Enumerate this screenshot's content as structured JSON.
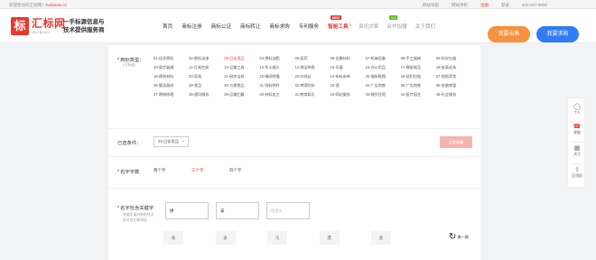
{
  "topbar": {
    "welcome": "欢迎您访问汇标网！",
    "site": "huibiaow.cn",
    "links": {
      "nav": "网站导航",
      "mobile": "网站手机",
      "register": "注册",
      "login": "登录",
      "phone": "400-027-9090"
    }
  },
  "header": {
    "logo_mark": "标",
    "logo_name": "汇标网",
    "logo_sub": "HUIBIAO",
    "slogan_line1": "一手标源信息与",
    "slogan_line2": "技术提供服务商",
    "nav": [
      {
        "label": "首页"
      },
      {
        "label": "商标注册"
      },
      {
        "label": "商标公证"
      },
      {
        "label": "商标转让"
      },
      {
        "label": "商标求购"
      },
      {
        "label": "专利服务"
      },
      {
        "label": "智能工具",
        "badge": "NEW",
        "active": true
      }
    ],
    "nav_secondary": [
      {
        "label": "资讯文章"
      },
      {
        "label": "合作加盟",
        "badge": "hot"
      },
      {
        "label": "关于我们"
      }
    ],
    "sell_button": "我要出售",
    "buy_button": "我要求购"
  },
  "form": {
    "category_label": "商标类型：",
    "category_note": "(可多选)",
    "categories": [
      "01-化学原料",
      "02-颜料油漆",
      "03-日化用品",
      "04-燃料油脂",
      "05-医药",
      "06-金属材料",
      "07-机械设备",
      "08-手工器械",
      "09-科学仪器",
      "10-医疗器械",
      "11-灯具空调",
      "12-运输工具",
      "13-军火烟火",
      "14-珠宝钟表",
      "15-乐器",
      "16-办公用品",
      "17-橡胶制品",
      "18-皮革皮具",
      "19-建筑材料",
      "20-家具",
      "21-厨房洁具",
      "22-绳网袋篷",
      "23-纱线丝",
      "24-布料床单",
      "25-服装鞋帽",
      "26-纽扣拉链",
      "27-地毯席垫",
      "28-健身器材",
      "29-食品",
      "30-方便食品",
      "31-饲料种籽",
      "32-啤酒饮料",
      "33-酒",
      "34-广告销售",
      "35-广告销售",
      "36-金融物管",
      "37-建筑修理",
      "38-通讯服务",
      "39-运输贮藏",
      "40-材料加工",
      "41-教育娱乐",
      "42-网站服务",
      "43-餐饮住宿",
      "44-医疗园艺",
      "45-社会服务"
    ],
    "selected_category_index": 2,
    "selected_label": "已选条件：",
    "selected_chip": "03-日化用品",
    "chip_close": "×",
    "fav_button": "立即收藏",
    "length_label": "名字字数",
    "length_options": [
      "两个字",
      "三个字",
      "四个字"
    ],
    "length_selected": 1,
    "keyword_label": "名字包含关键字",
    "keyword_note1": "关键字请勿带有特点",
    "keyword_note2": "您可在左侧添加",
    "inputs": [
      {
        "value": "拼"
      },
      {
        "value": "拿"
      },
      {
        "placeholder": "任意2"
      }
    ],
    "suggestions": [
      "采",
      "多",
      "马",
      "漂",
      "金"
    ],
    "refresh_label": "换一换",
    "refresh_icon": "refresh-icon"
  },
  "sidebar": {
    "items": [
      {
        "icon": "person-icon",
        "label": "个人"
      },
      {
        "icon": "headset-icon",
        "label": "客服"
      },
      {
        "icon": "qrcode-icon",
        "label": "关注"
      },
      {
        "icon": "arrow-up-icon",
        "label": "回顶部"
      }
    ]
  },
  "colors": {
    "brand_red": "#e8382f",
    "sell_orange": "#f5923e",
    "buy_blue": "#2f7cf6"
  }
}
